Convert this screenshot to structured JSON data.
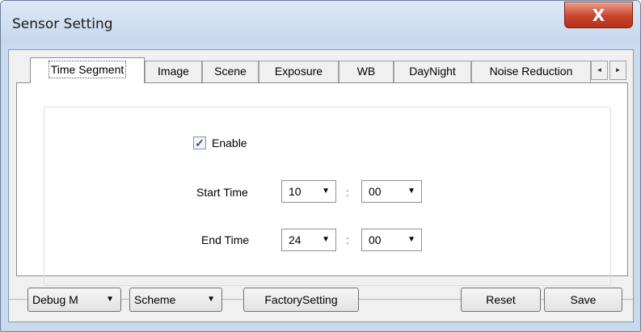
{
  "window": {
    "title": "Sensor Setting",
    "close_glyph": "X"
  },
  "tabs": [
    {
      "label": "Time Segment",
      "active": true
    },
    {
      "label": "Image"
    },
    {
      "label": "Scene"
    },
    {
      "label": "Exposure"
    },
    {
      "label": "WB"
    },
    {
      "label": "DayNight"
    },
    {
      "label": "Noise Reduction"
    }
  ],
  "tab_arrows": {
    "left": "◄",
    "right": "►"
  },
  "time_segment": {
    "enable": {
      "label": "Enable",
      "checked": true,
      "check_glyph": "✓"
    },
    "start_time": {
      "label": "Start Time",
      "hour": "10",
      "minute": "00"
    },
    "end_time": {
      "label": "End Time",
      "hour": "24",
      "minute": "00"
    },
    "separator": ":"
  },
  "bottom": {
    "debug_mode": "Debug M",
    "scheme": "Scheme",
    "factory_setting": "FactorySetting",
    "reset": "Reset",
    "save": "Save"
  },
  "icons": {
    "dropdown": "▼"
  },
  "colors": {
    "accent": "#2a4f9e",
    "close": "#c8442c"
  }
}
